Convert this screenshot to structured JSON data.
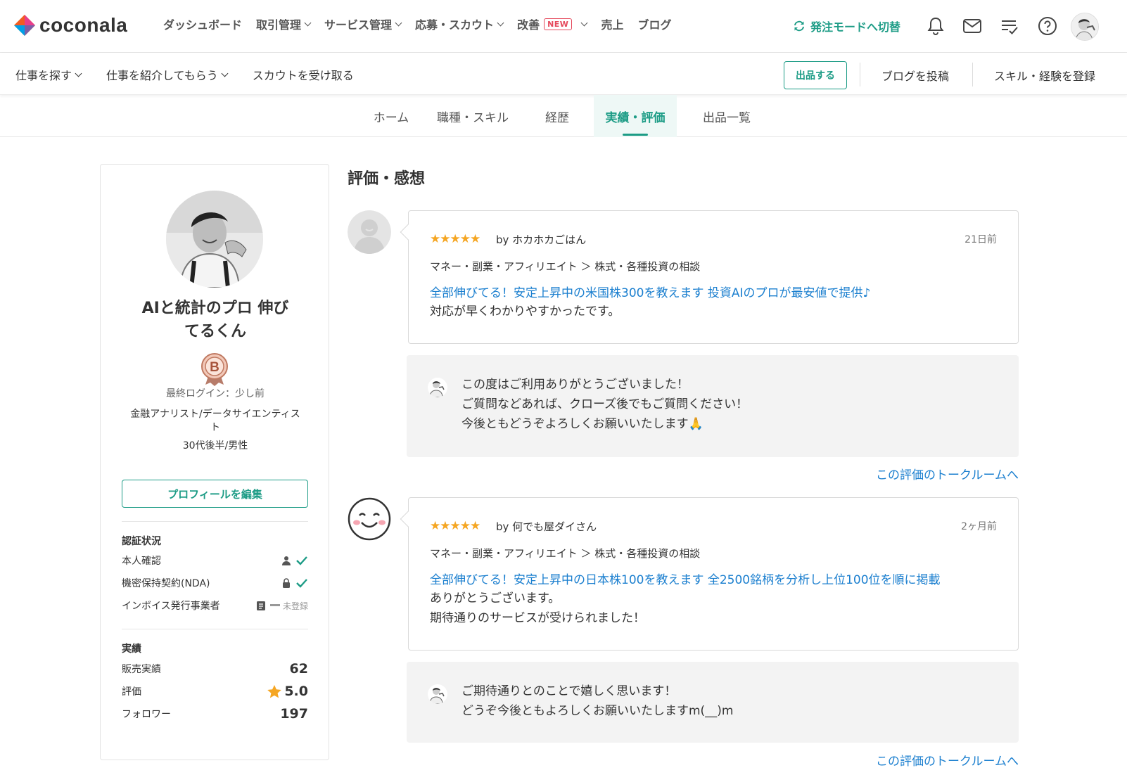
{
  "header": {
    "logo_text": "coconala",
    "nav": [
      {
        "label": "ダッシュボード",
        "has_menu": false
      },
      {
        "label": "取引管理",
        "has_menu": true
      },
      {
        "label": "サービス管理",
        "has_menu": true
      },
      {
        "label": "応募・スカウト",
        "has_menu": true
      },
      {
        "label": "改善",
        "badge": "NEW",
        "has_menu": true
      },
      {
        "label": "売上",
        "has_menu": false
      },
      {
        "label": "ブログ",
        "has_menu": false
      }
    ],
    "switch_mode": "発注モードへ切替",
    "icons": [
      "bell-icon",
      "mail-icon",
      "checklist-icon",
      "help-icon"
    ]
  },
  "subbar": {
    "find_work": "仕事を探す",
    "get_introduced": "仕事を紹介してもらう",
    "receive_scout": "スカウトを受け取る",
    "post_button": "出品する",
    "post_blog": "ブログを投稿",
    "register_skill": "スキル・経験を登録"
  },
  "tabs": [
    {
      "label": "ホーム",
      "active": false
    },
    {
      "label": "職種・スキル",
      "active": false
    },
    {
      "label": "経歴",
      "active": false
    },
    {
      "label": "実績・評価",
      "active": true
    },
    {
      "label": "出品一覧",
      "active": false
    }
  ],
  "profile": {
    "name_line1": "AIと統計のプロ 伸び",
    "name_line2": "てるくん",
    "rank": "B",
    "last_login": "最終ログイン：少し前",
    "job_line1": "金融アナリスト/データサイエンティス",
    "job_line2": "ト",
    "age_gender": "30代後半/男性",
    "edit_button": "プロフィールを編集",
    "verification_title": "認証状況",
    "verifications": [
      {
        "label": "本人確認"
      },
      {
        "label": "機密保持契約(NDA)"
      },
      {
        "label": "インボイス発行事業者",
        "status": "未登録"
      }
    ],
    "stats_title": "実績",
    "stats": [
      {
        "label": "販売実績",
        "value": "62"
      },
      {
        "label": "評価",
        "value": "5.0"
      },
      {
        "label": "フォロワー",
        "value": "197"
      }
    ]
  },
  "reviews": {
    "title": "評価・感想",
    "items": [
      {
        "stars": "★★★★★",
        "by": "by ホカホカごはん",
        "date": "21日前",
        "category": "マネー・副業・アフィリエイト ＞ 株式・各種投資の相談",
        "service": "全部伸びてる！安定上昇中の米国株300を教えます 投資AIのプロが最安値で提供♪",
        "text": [
          "対応が早くわかりやすかったです。"
        ],
        "reply": [
          "この度はご利用ありがとうございました！",
          "ご質問などあれば、クローズ後でもご質問ください！",
          "今後ともどうぞよろしくお願いいたします🙏"
        ],
        "talk_link": "この評価のトークルームへ"
      },
      {
        "stars": "★★★★★",
        "by": "by 何でも屋ダイさん",
        "date": "2ヶ月前",
        "category": "マネー・副業・アフィリエイト ＞ 株式・各種投資の相談",
        "service": "全部伸びてる！安定上昇中の日本株100を教えます 全2500銘柄を分析し上位100位を順に掲載",
        "text": [
          "ありがとうございます。",
          "期待通りのサービスが受けられました！"
        ],
        "reply": [
          "ご期待通りとのことで嬉しく思います！",
          "どうぞ今後ともよろしくお願いいたしますm(__)m"
        ],
        "talk_link": "この評価のトークルームへ"
      }
    ]
  },
  "colors": {
    "accent": "#1d9c86",
    "link": "#1b7fcf",
    "star": "#f5a623",
    "new_badge": "#e5485b"
  }
}
